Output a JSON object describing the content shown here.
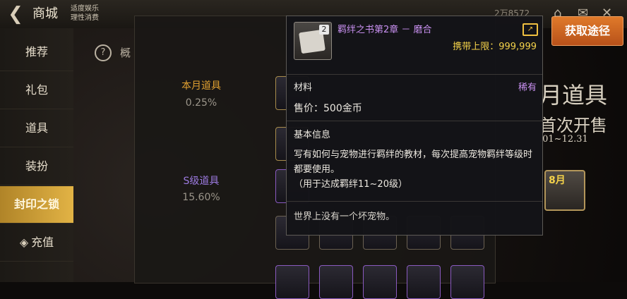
{
  "topbar": {
    "back_icon": "back-arrow-icon",
    "title": "商城",
    "age_note_line1": "适度娱乐",
    "age_note_line2": "理性消费",
    "currency_text": "2万8572",
    "icons": [
      "shop-bag-icon",
      "home-icon",
      "mail-icon",
      "close-icon"
    ]
  },
  "sidebar": {
    "items": [
      {
        "label": "推荐"
      },
      {
        "label": "礼包"
      },
      {
        "label": "道具"
      },
      {
        "label": "装扮"
      },
      {
        "label": "封印之锁"
      },
      {
        "label": "充值"
      }
    ],
    "active_index": 4
  },
  "overview": {
    "help_symbol": "?",
    "label": "概"
  },
  "probabilities": [
    {
      "name": "本月道具",
      "value": "0.25%"
    },
    {
      "name": "S级道具",
      "value": "15.60%"
    }
  ],
  "banner": {
    "line1": "月道具",
    "line2": "首次开售",
    "dates": ".01~12.31",
    "item_badge": "8月"
  },
  "acquire_button": "获取途径",
  "tooltip": {
    "title": "羁绊之书第2章 － 磨合",
    "icon_badge": "2",
    "carry_limit": "携带上限：999,999",
    "category": "材料",
    "rarity": "稀有",
    "price": "售价：500金币",
    "basic_info_header": "基本信息",
    "description": "写有如何与宠物进行羁绊的教材，每次提高宠物羁绊等级时都要使用。",
    "note": "（用于达成羁绊11~20级）",
    "quote": "世界上没有一个坏宠物。"
  },
  "colors": {
    "purple_text": "#c890f0",
    "gold_text": "#f4d24a",
    "active_tab": "#e2b345",
    "acquire_button": "#d06a24",
    "prob_monthly": "#e0a030",
    "prob_s": "#9c7ae0"
  }
}
